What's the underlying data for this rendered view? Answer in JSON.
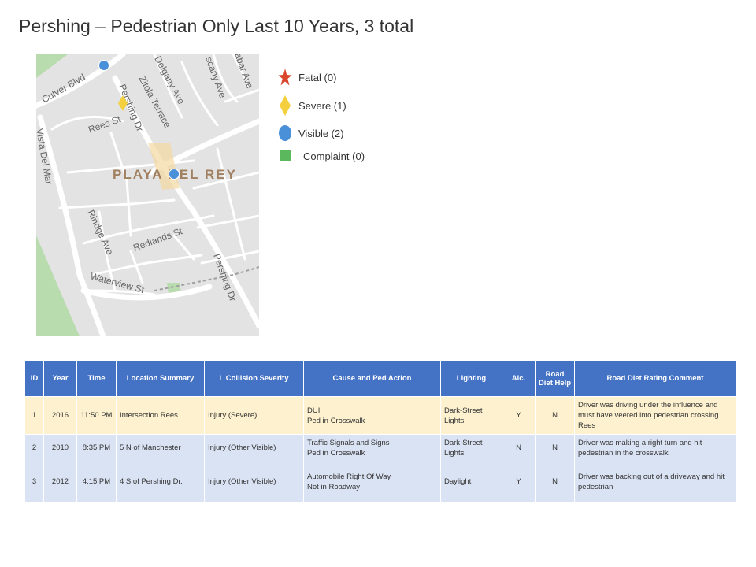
{
  "title": "Pershing – Pedestrian Only Last 10 Years, 3 total",
  "colors": {
    "fatal": "#d9462a",
    "severe": "#f4d03f",
    "visible": "#4a90d9",
    "complaint": "#5cb85c",
    "header": "#4472c4",
    "row_severe": "#fdf1cf",
    "row_visible": "#dae3f3"
  },
  "map": {
    "neighborhood": "PLAYA DEL REY",
    "streets": [
      "Culver Blvd",
      "Delgany Ave",
      "Zitola Terrace",
      "Pershing Dr",
      "Rees St",
      "Vista Del Mar",
      "Rindge Ave",
      "Redlands St",
      "Waterview St",
      "Pershing Dr",
      "scany Ave",
      "abar Ave"
    ]
  },
  "legend": [
    {
      "icon": "star-icon",
      "label": "Fatal (0)"
    },
    {
      "icon": "diamond-icon",
      "label": "Severe (1)"
    },
    {
      "icon": "circle-icon",
      "label": "Visible (2)"
    },
    {
      "icon": "square-icon",
      "label": "Complaint (0)"
    }
  ],
  "table": {
    "headers": [
      "ID",
      "Year",
      "Time",
      "Location Summary",
      "L Collision Severity",
      "Cause and Ped Action",
      "Lighting",
      "Alc.",
      "Road Diet Help",
      "Road Diet Rating Comment"
    ],
    "rows": [
      {
        "type": "severe",
        "id": "1",
        "year": "2016",
        "time": "11:50 PM",
        "location": "Intersection Rees",
        "severity": "Injury (Severe)",
        "cause": [
          "DUI",
          "Ped in Crosswalk"
        ],
        "lighting": "Dark-Street Lights",
        "alc": "Y",
        "road_diet": "N",
        "comment": "Driver was driving under the influence and must have veered into pedestrian crossing Rees"
      },
      {
        "type": "visible",
        "id": "2",
        "year": "2010",
        "time": "8:35 PM",
        "location": "5 N of Manchester",
        "severity": "Injury (Other Visible)",
        "cause": [
          "Traffic Signals and Signs",
          "Ped in Crosswalk"
        ],
        "lighting": "Dark-Street Lights",
        "alc": "N",
        "road_diet": "N",
        "comment": "Driver was making a right turn and hit pedestrian in the crosswalk"
      },
      {
        "type": "visible",
        "id": "3",
        "year": "2012",
        "time": "4:15 PM",
        "location": "4 S of Pershing Dr.",
        "severity": "Injury (Other Visible)",
        "cause": [
          "Automobile Right Of Way",
          "Not in Roadway"
        ],
        "lighting": "Daylight",
        "alc": "Y",
        "road_diet": "N",
        "comment": "Driver was backing out of a driveway and hit pedestrian"
      }
    ]
  }
}
